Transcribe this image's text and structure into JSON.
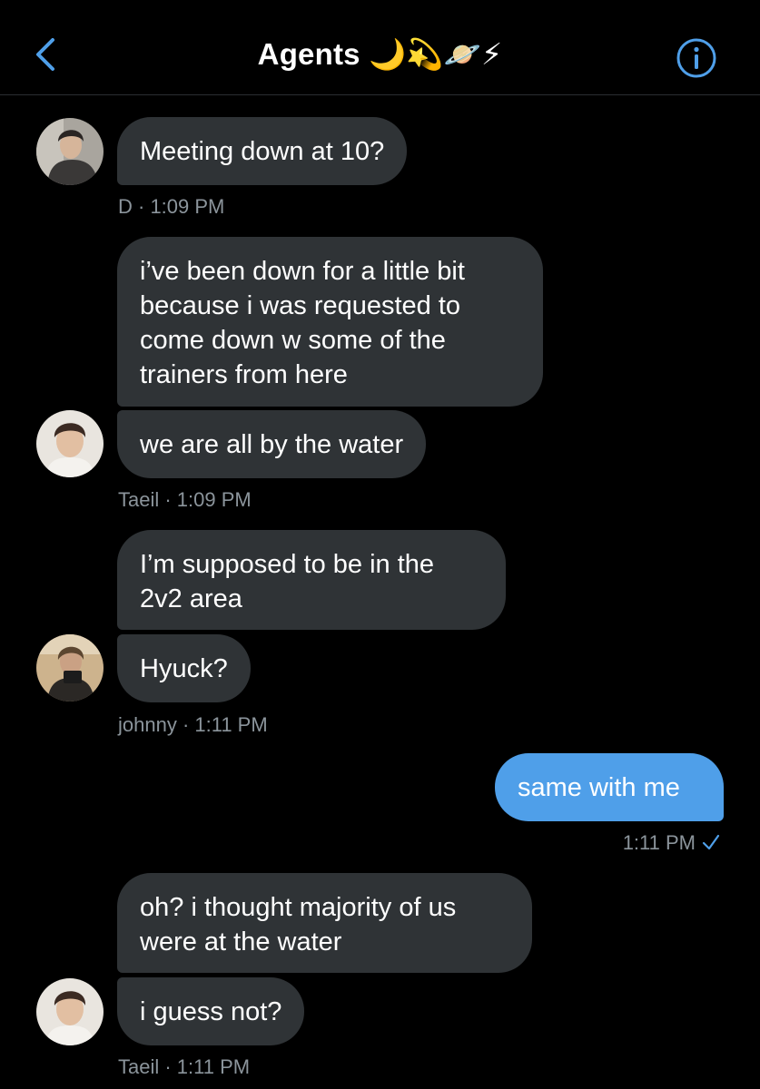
{
  "header": {
    "title": "Agents",
    "title_emojis": "🌙💫🪐⚡",
    "back_icon": "chevron-left-icon",
    "info_icon": "info-circle-icon",
    "accent_color": "#4f9fe9"
  },
  "messages": [
    {
      "sender": "D",
      "text": "Meeting down at 10?",
      "time": "1:09 PM",
      "meta": "D · 1:09 PM"
    },
    {
      "sender": "Taeil",
      "text_lines": [
        "i’ve been down for a little bit",
        "because i was requested to",
        "come down w some of the",
        "trainers from here"
      ]
    },
    {
      "sender": "Taeil",
      "text": "we are all by the water",
      "meta": "Taeil · 1:09 PM"
    },
    {
      "sender": "johnny",
      "text_lines": [
        "I’m supposed to be in the",
        "2v2 area"
      ]
    },
    {
      "sender": "johnny",
      "text": "Hyuck?",
      "meta": "johnny · 1:11 PM"
    },
    {
      "sender": "me",
      "text": "same with me",
      "meta": "1:11 PM"
    },
    {
      "sender": "Taeil",
      "text_lines": [
        "oh? i thought majority of us",
        "were at the water"
      ]
    },
    {
      "sender": "Taeil",
      "text": "i guess not?",
      "meta": "Taeil · 1:11 PM"
    }
  ],
  "colors": {
    "background": "#000000",
    "incoming_bubble": "#2f3336",
    "outgoing_bubble": "#4f9fe9",
    "meta_text": "#8b949b"
  }
}
